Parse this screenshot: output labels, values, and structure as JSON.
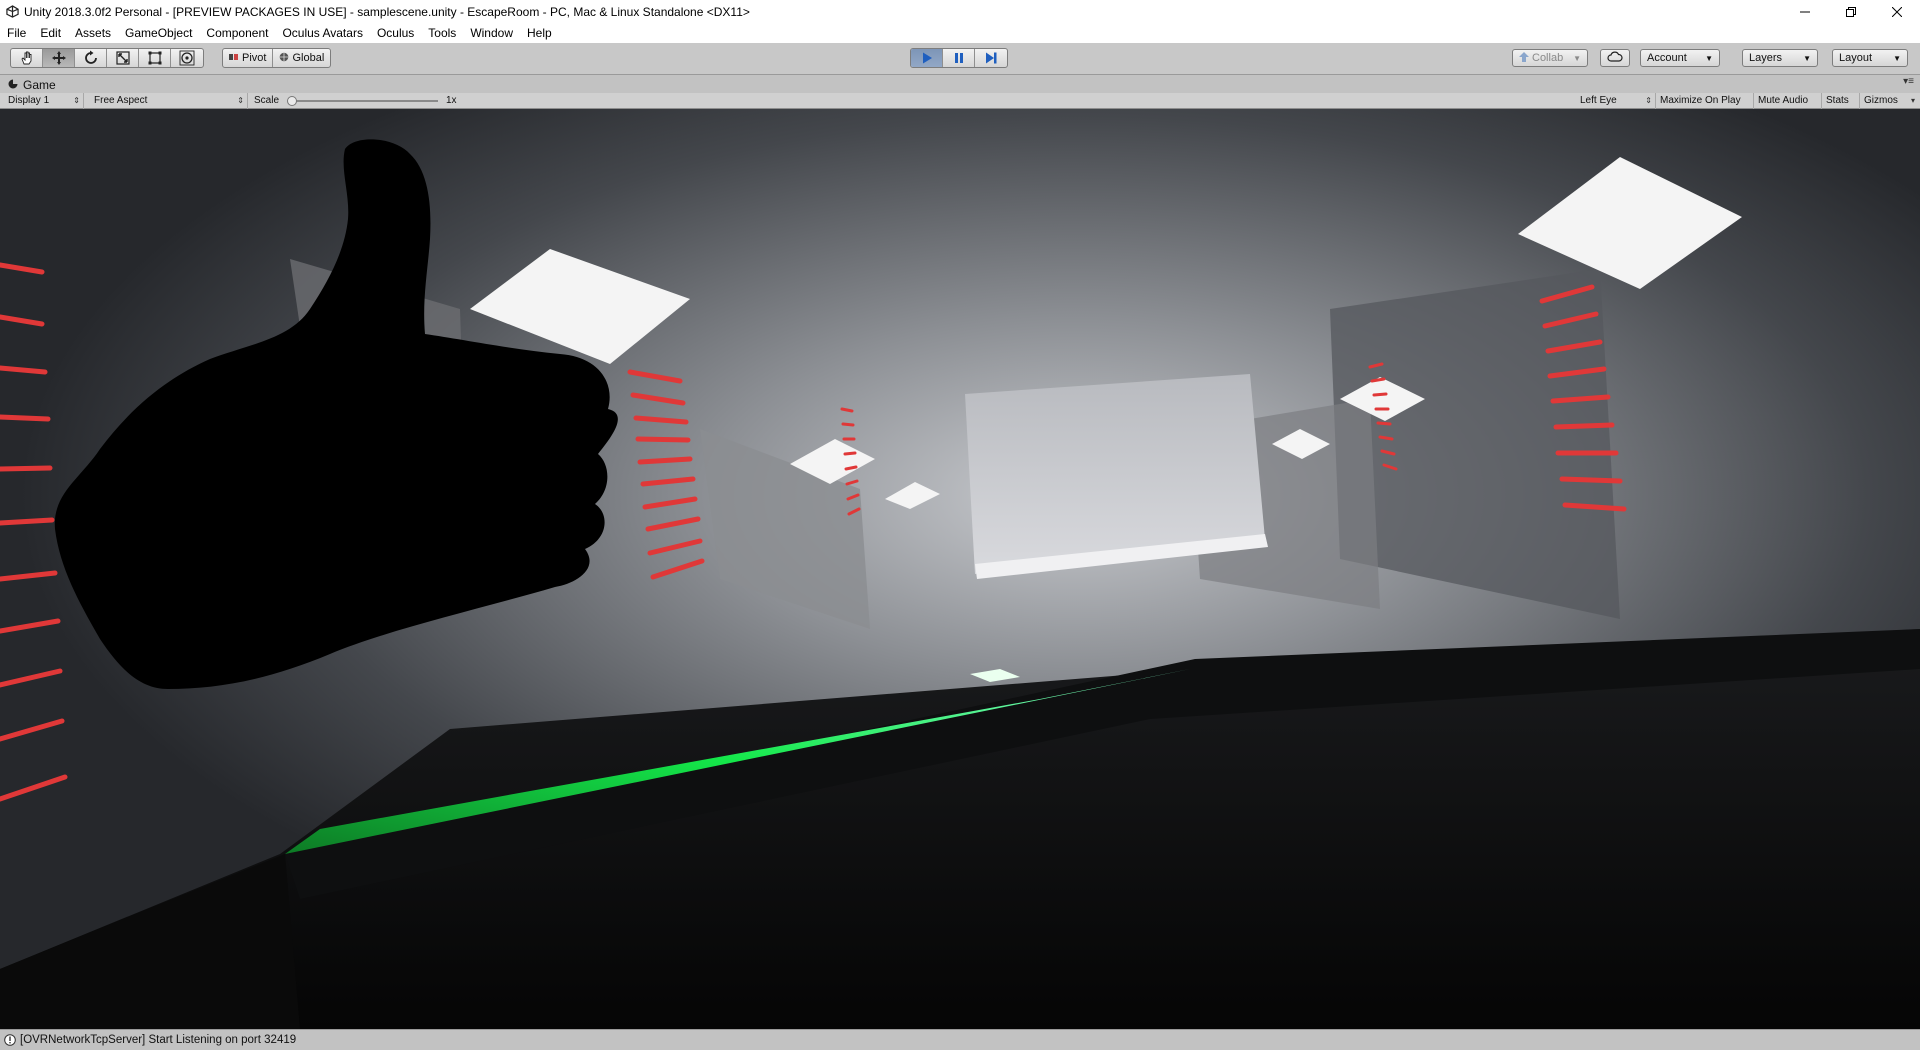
{
  "window": {
    "title": "Unity 2018.3.0f2 Personal - [PREVIEW PACKAGES IN USE] - samplescene.unity - EscapeRoom - PC, Mac & Linux Standalone <DX11>",
    "app_icon": "unity-logo-icon",
    "controls": [
      "minimize-icon",
      "restore-icon",
      "close-icon"
    ]
  },
  "menu": {
    "items": [
      "File",
      "Edit",
      "Assets",
      "GameObject",
      "Component",
      "Oculus Avatars",
      "Oculus",
      "Tools",
      "Window",
      "Help"
    ]
  },
  "toolbar": {
    "transform_tools": [
      "hand-icon",
      "move-icon",
      "rotate-icon",
      "scale-icon",
      "rect-icon",
      "transform-icon"
    ],
    "active_tool": "move-icon",
    "pivot_label": "Pivot",
    "global_label": "Global",
    "play_controls": [
      "play-icon",
      "pause-icon",
      "step-icon"
    ],
    "playing": true,
    "collab_label": "Collab",
    "cloud_icon": "cloud-icon",
    "account_label": "Account",
    "layers_label": "Layers",
    "layout_label": "Layout"
  },
  "game_panel": {
    "tab_label": "Game",
    "tab_icon": "game-controller-icon",
    "display_label": "Display 1",
    "aspect_label": "Free Aspect",
    "scale_label": "Scale",
    "scale_value": "1x",
    "scale_level": 0,
    "eye_label": "Left Eye",
    "maximize_label": "Maximize On Play",
    "mute_label": "Mute Audio",
    "stats_label": "Stats",
    "gizmos_label": "Gizmos"
  },
  "status": {
    "icon": "info-icon",
    "message": "[OVRNetworkTcpServer] Start Listening on port 32419"
  },
  "colors": {
    "accent_play": "#6f8fbf",
    "laser_green": "#22e04a",
    "wall_stripe_red": "#e03a3a",
    "ceiling_light": "#f2f2f2"
  }
}
